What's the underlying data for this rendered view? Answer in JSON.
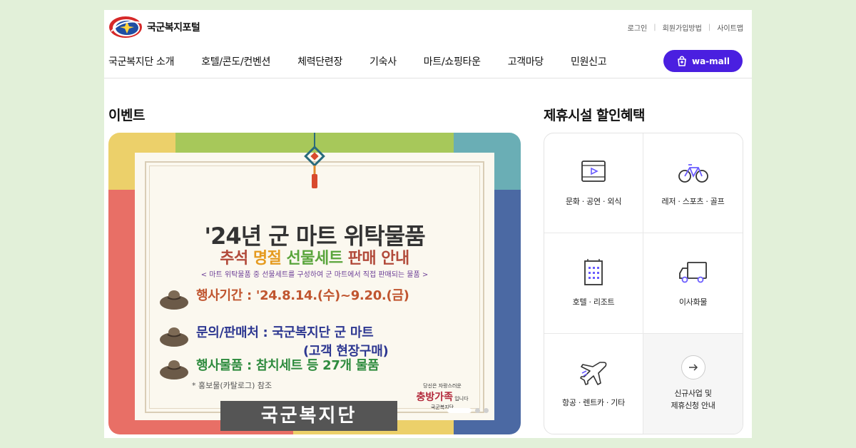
{
  "header": {
    "logo_text": "국군복지포털",
    "util_links": [
      "로그인",
      "회원가입방법",
      "사이트맵"
    ]
  },
  "nav": [
    "국군복지단 소개",
    "호텔/콘도/컨벤션",
    "체력단련장",
    "기숙사",
    "마트/쇼핑타운",
    "고객마당",
    "민원신고"
  ],
  "wamall_label": "wa-mall",
  "event": {
    "title": "이벤트",
    "poster": {
      "headline": "'24년 군 마트 위탁물품",
      "subline_parts": [
        "추석",
        "명절",
        "선물세트",
        "판매 안내"
      ],
      "note": "< 마트 위탁물품 중 선물세트를 구성하여 군 마트에서 직접 판매되는 물품 >",
      "period": "행사기간 : '24.8.14.(수)~9.20.(금)",
      "contact": "문의/판매처 : 국군복지단 군 마트",
      "contact_sub": "(고객 현장구매)",
      "items": "행사물품 : 참치세트 등 27개 물품",
      "ref": "* 홍보물(카탈로그) 참조",
      "footer_box": "국군복지단",
      "sign_top": "당신은 자랑스러운",
      "sign_brand": "충방가족",
      "sign_tail": "입니다",
      "sign_org": "국군복지단"
    },
    "slide_count": 3,
    "active_slide": 1
  },
  "partners": {
    "title": "제휴시설 할인혜택",
    "cells": [
      {
        "label": "문화 · 공연 · 외식",
        "icon": "video-icon"
      },
      {
        "label": "레저 · 스포츠 · 골프",
        "icon": "bicycle-icon"
      },
      {
        "label": "호텔 · 리조트",
        "icon": "building-icon"
      },
      {
        "label": "이사화물",
        "icon": "truck-icon"
      },
      {
        "label": "항공 · 렌트카 · 기타",
        "icon": "airplane-icon"
      },
      {
        "label_line1": "신규사업 및",
        "label_line2": "제휴신청 안내",
        "icon": "arrow-right-icon"
      }
    ]
  },
  "colors": {
    "accent": "#4a1fe0",
    "icon_stroke": "#333333",
    "icon_accent": "#6a5cff"
  }
}
